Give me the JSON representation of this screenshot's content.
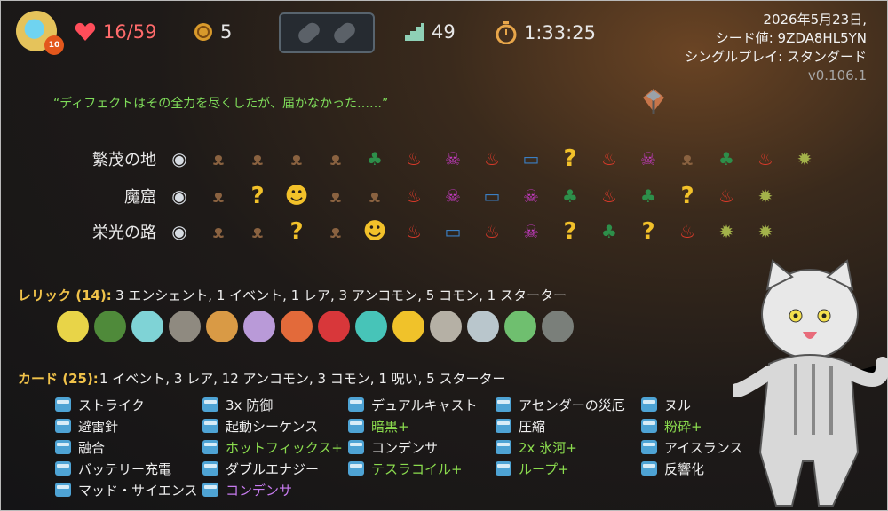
{
  "header": {
    "hp": "16/59",
    "gold": "5",
    "floor": "49",
    "time": "1:33:25",
    "ascension_badge": "10",
    "date": "2026年5月23日,",
    "seed": "シード値: 9ZDA8HL5YN",
    "mode": "シングルプレイ: スタンダード",
    "version": "v0.106.1"
  },
  "colors": {
    "hp": "#ff6b6b",
    "gold_title": "#f0c24a",
    "upgraded": "#8bdc4e",
    "curse": "#c77bf0",
    "quote": "#7fdc5a"
  },
  "quote": "“ディフェクトはその全力を尽くしたが、届かなかった……”",
  "acts": [
    {
      "label": "繁茂の地",
      "nodes": [
        "treasure",
        "monster",
        "monster",
        "monster",
        "monster",
        "rest",
        "elite",
        "event",
        "elite",
        "shop",
        "unknown",
        "elite",
        "event",
        "monster",
        "rest",
        "elite",
        "boss"
      ]
    },
    {
      "label": "魔窟",
      "nodes": [
        "treasure",
        "monster",
        "unknown",
        "unknown-gold",
        "monster",
        "monster",
        "elite",
        "event",
        "shop",
        "event",
        "rest",
        "elite",
        "rest",
        "unknown",
        "elite",
        "boss"
      ]
    },
    {
      "label": "栄光の路",
      "nodes": [
        "treasure",
        "monster",
        "monster",
        "unknown",
        "monster",
        "unknown-gold",
        "elite",
        "shop",
        "elite",
        "event",
        "unknown",
        "rest",
        "unknown",
        "elite",
        "boss",
        "boss"
      ]
    }
  ],
  "relics": {
    "title": "レリック (14):",
    "summary": "3 エンシェント, 1 イベント, 1 レア, 3 アンコモン, 5 コモン, 1 スターター",
    "items": [
      "yellow-orb-icon",
      "green-bush-icon",
      "cyan-crystal-icon",
      "candelabra-icon",
      "leaves-icon",
      "hook-icon",
      "flame-crown-icon",
      "red-snake-icon",
      "cage-icon",
      "sun-icon",
      "fan-icon",
      "stone-icon",
      "flag-icon",
      "lantern-icon"
    ]
  },
  "cards": {
    "title": "カード (25):",
    "summary": "1 イベント, 3 レア, 12 アンコモン, 3 コモン, 1 呪い, 5 スターター",
    "columns": [
      [
        {
          "name": "ストライク",
          "kind": "normal"
        },
        {
          "name": "避雷針",
          "kind": "normal"
        },
        {
          "name": "融合",
          "kind": "normal"
        },
        {
          "name": "バッテリー充電",
          "kind": "normal"
        },
        {
          "name": "マッド・サイエンス",
          "kind": "normal"
        }
      ],
      [
        {
          "name": "3x 防御",
          "kind": "normal"
        },
        {
          "name": "起動シーケンス",
          "kind": "normal"
        },
        {
          "name": "ホットフィックス+",
          "kind": "up"
        },
        {
          "name": "ダブルエナジー",
          "kind": "normal"
        },
        {
          "name": "コンデンサ",
          "kind": "curse"
        }
      ],
      [
        {
          "name": "デュアルキャスト",
          "kind": "normal"
        },
        {
          "name": "暗黒+",
          "kind": "up"
        },
        {
          "name": "コンデンサ",
          "kind": "normal"
        },
        {
          "name": "テスラコイル+",
          "kind": "up"
        }
      ],
      [
        {
          "name": "アセンダーの災厄",
          "kind": "normal"
        },
        {
          "name": "圧縮",
          "kind": "normal"
        },
        {
          "name": "2x 氷河+",
          "kind": "up"
        },
        {
          "name": "ループ+",
          "kind": "up"
        }
      ],
      [
        {
          "name": "ヌル",
          "kind": "normal"
        },
        {
          "name": "粉砕+",
          "kind": "up"
        },
        {
          "name": "アイスランス",
          "kind": "normal"
        },
        {
          "name": "反響化",
          "kind": "normal"
        }
      ]
    ]
  }
}
